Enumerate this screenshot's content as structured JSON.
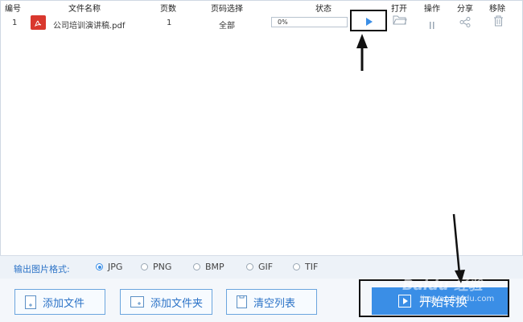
{
  "table": {
    "headers": {
      "index": "编号",
      "filename": "文件名称",
      "pages": "页数",
      "page_select": "页码选择",
      "status": "状态",
      "open": "打开",
      "operate": "操作",
      "share": "分享",
      "remove": "移除"
    },
    "rows": [
      {
        "index": "1",
        "filename": "公司培训演讲稿.pdf",
        "pages": "1",
        "page_select": "全部",
        "progress_text": "0%",
        "progress": 0
      }
    ]
  },
  "format": {
    "label": "输出图片格式:",
    "options": [
      "JPG",
      "PNG",
      "BMP",
      "GIF",
      "TIF"
    ],
    "selected": "JPG"
  },
  "buttons": {
    "add_file": "添加文件",
    "add_folder": "添加文件夹",
    "clear_list": "清空列表",
    "start_convert": "开始转换"
  },
  "watermark": {
    "brand": "Baidu 经验",
    "url": "jingyan.baidu.com"
  },
  "colors": {
    "accent": "#3a8ee6",
    "pdf": "#d9382e",
    "annotation": "#111111"
  },
  "icons": {
    "file_type": "pdf-icon",
    "start": "play-icon",
    "open": "folder-icon",
    "operate": "pause-icon",
    "share": "share-icon",
    "remove": "trash-icon"
  }
}
